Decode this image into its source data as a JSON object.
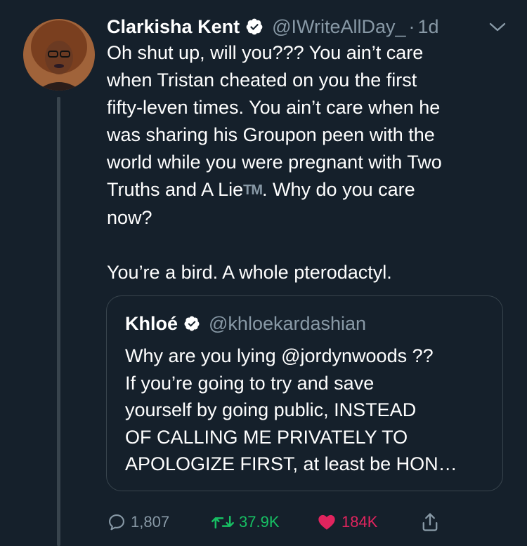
{
  "tweet": {
    "author_name": "Clarkisha Kent",
    "author_handle": "@IWriteAllDay_",
    "separator": "·",
    "time": "1d",
    "lines": [
      "Oh shut up, will you??? You ain’t care",
      "when Tristan cheated on you the first",
      "fifty-leven times. You ain’t care when he",
      "was sharing his Groupon peen with the",
      "world while you were pregnant with Two"
    ],
    "line6_before_tm": "Truths and A Lie",
    "tm": "TM",
    "line6_after_tm": ". Why do you care",
    "line7": "now?",
    "line8": "You’re a bird. A whole pterodactyl."
  },
  "quote": {
    "author_name": "Khloé",
    "author_handle": "@khloekardashian",
    "lines": [
      "Why are you lying @jordynwoods ??",
      "If you’re going to try and save",
      "yourself by going public, INSTEAD",
      "OF CALLING ME PRIVATELY TO",
      "APOLOGIZE FIRST, at least be HON…"
    ]
  },
  "actions": {
    "replies": "1,807",
    "retweets": "37.9K",
    "likes": "184K"
  },
  "icons": {
    "verified": "verified-badge-icon",
    "caret": "chevron-down-icon",
    "reply": "reply-icon",
    "retweet": "retweet-icon",
    "like": "heart-icon",
    "share": "share-icon"
  },
  "colors": {
    "background": "#15202b",
    "secondary_text": "#8899a6",
    "retweet_active": "#17bf63",
    "like_active": "#e0245e",
    "border": "#38444d"
  }
}
